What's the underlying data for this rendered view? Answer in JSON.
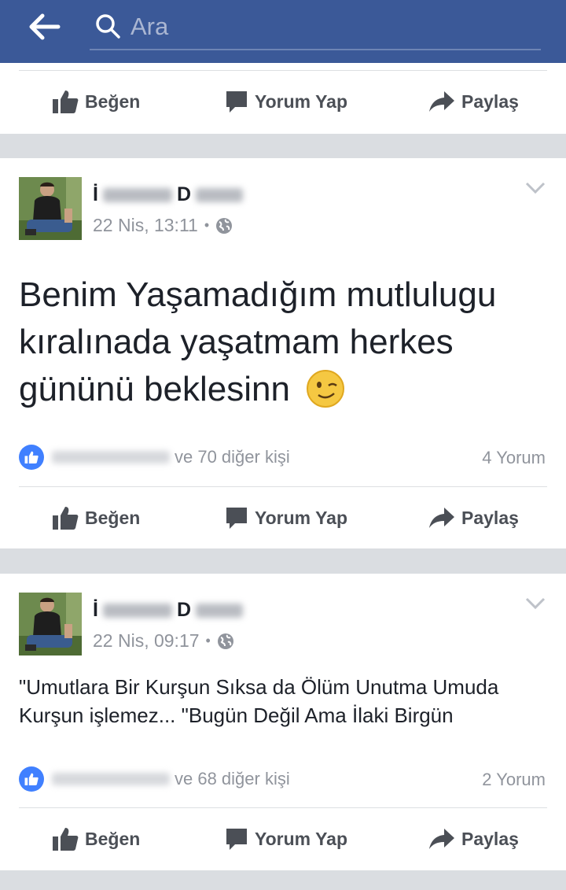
{
  "search": {
    "placeholder": "Ara"
  },
  "actions": {
    "like": "Beğen",
    "comment": "Yorum Yap",
    "share": "Paylaş"
  },
  "posts": [
    {
      "name_first": "İ",
      "name_last": "D",
      "timestamp": "22 Nis, 13:11",
      "text": "Benim Yaşamadığım mutlulugu kıralınada yaşatmam herkes gününü beklesinn",
      "likes_text": "ve 70 diğer kişi",
      "comments_text": "4 Yorum"
    },
    {
      "name_first": "İ",
      "name_last": "D",
      "timestamp": "22 Nis, 09:17",
      "text": "\"Umutlara Bir Kurşun Sıksa da Ölüm Unutma Umuda Kurşun işlemez... \"Bugün Değil Ama İlaki Birgün",
      "likes_text": "ve 68 diğer kişi",
      "comments_text": "2 Yorum"
    }
  ],
  "colors": {
    "header": "#3b5998",
    "like_badge": "#4080ff",
    "muted": "#90949c"
  }
}
